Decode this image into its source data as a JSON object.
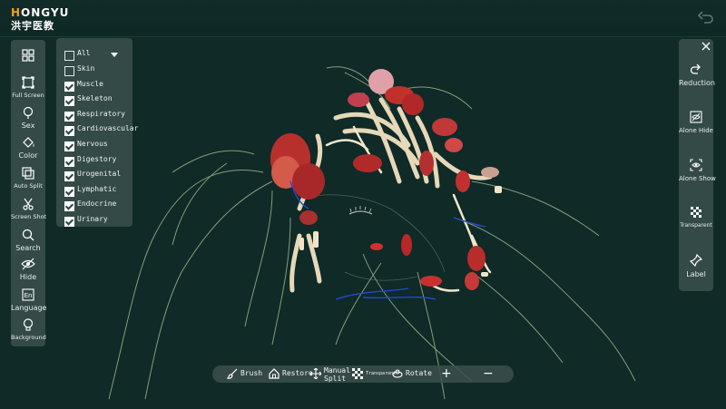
{
  "brand": {
    "logo_line1": "HONGYU",
    "logo_line2": "洪宇医教",
    "accent_color": "#f0a020"
  },
  "top": {
    "back_icon": "undo-arrow-icon"
  },
  "left_toolbar": [
    {
      "label": "",
      "icon": "grid-icon"
    },
    {
      "label": "Full Screen",
      "icon": "fullscreen-icon"
    },
    {
      "label": "Sex",
      "icon": "sex-icon"
    },
    {
      "label": "Color",
      "icon": "color-icon"
    },
    {
      "label": "Auto Split",
      "icon": "auto-split-icon"
    },
    {
      "label": "Screen Shot",
      "icon": "scissors-icon"
    },
    {
      "label": "Search",
      "icon": "search-icon"
    },
    {
      "label": "Hide",
      "icon": "eye-hide-icon"
    },
    {
      "label": "Language",
      "icon": "language-icon"
    },
    {
      "label": "Background",
      "icon": "bulb-icon"
    }
  ],
  "layers": {
    "all_label": "All",
    "all_checked": false,
    "items": [
      {
        "label": "Skin",
        "checked": false
      },
      {
        "label": "Muscle",
        "checked": true
      },
      {
        "label": "Skeleton",
        "checked": true
      },
      {
        "label": "Respiratory",
        "checked": true
      },
      {
        "label": "Cardiovascular",
        "checked": true
      },
      {
        "label": "Nervous",
        "checked": true
      },
      {
        "label": "Digestory",
        "checked": true
      },
      {
        "label": "Urogenital",
        "checked": true
      },
      {
        "label": "Lymphatic",
        "checked": true
      },
      {
        "label": "Endocrine",
        "checked": true
      },
      {
        "label": "Urinary",
        "checked": true
      }
    ]
  },
  "right_panel": {
    "close_icon": "close-icon",
    "items": [
      {
        "label": "Reduction",
        "icon": "redo-icon"
      },
      {
        "label": "Alone Hide",
        "icon": "alone-hide-icon"
      },
      {
        "label": "Alone Show",
        "icon": "alone-show-icon"
      },
      {
        "label": "Transparent",
        "icon": "checker-icon"
      },
      {
        "label": "Label",
        "icon": "pin-icon"
      }
    ]
  },
  "bottom_bar": {
    "brush": "Brush",
    "restore": "Restore",
    "manual_split_1": "Manual",
    "manual_split_2": "Split",
    "transparent": "Transparent",
    "rotate": "Rotate",
    "plus": "+",
    "minus": "−"
  },
  "colors": {
    "background": "#0f2a27",
    "panel": "#3a504d",
    "muscle": "#c2302c",
    "bone": "#e8dcc0",
    "nerve": "#bfd4a0",
    "vessel": "#2848c8"
  }
}
